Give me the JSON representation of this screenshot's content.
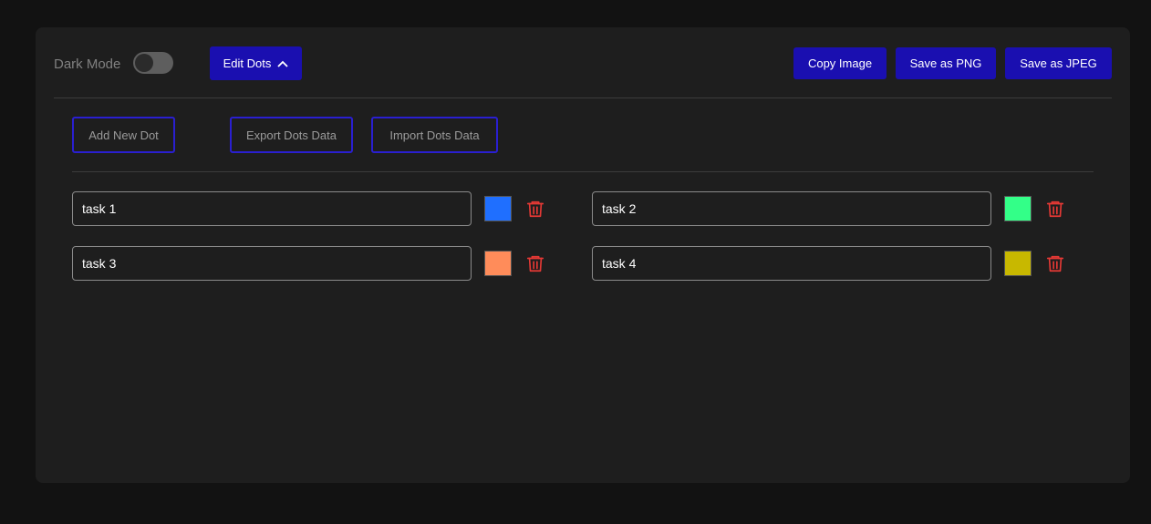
{
  "header": {
    "dark_mode_label": "Dark Mode",
    "dark_mode_on": false,
    "edit_dots_label": "Edit Dots",
    "copy_image_label": "Copy Image",
    "save_png_label": "Save as PNG",
    "save_jpeg_label": "Save as JPEG"
  },
  "editor": {
    "add_label": "Add New Dot",
    "export_label": "Export Dots Data",
    "import_label": "Import Dots Data",
    "dots": [
      {
        "name": "task 1",
        "color": "#1f6fff"
      },
      {
        "name": "task 2",
        "color": "#33ff88"
      },
      {
        "name": "task 3",
        "color": "#ff8c5a"
      },
      {
        "name": "task 4",
        "color": "#c8b800"
      }
    ]
  },
  "icons": {
    "edit_chevron": "chevron-up-icon",
    "delete": "trash-icon"
  },
  "colors": {
    "accent": "#1a0fb0",
    "delete": "#e53935"
  }
}
